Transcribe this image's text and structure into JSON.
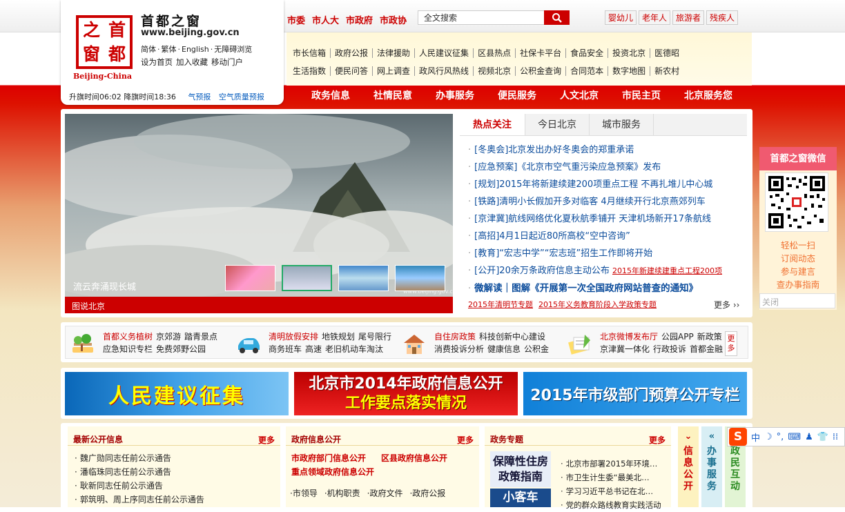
{
  "header": {
    "seal_chars": [
      "首",
      "之",
      "都",
      "窗"
    ],
    "seal_en": "Beijing-China",
    "site_name": "首都之窗",
    "url": "www.beijing.gov.cn",
    "langs": [
      "简体",
      "·",
      "繁体",
      "·",
      "English",
      "·",
      "无障碍浏览"
    ],
    "home_links": [
      "设为首页",
      "加入收藏",
      "移动门户"
    ],
    "flag_up": "升旗时间06:02",
    "flag_down": "降旗时间18:36",
    "weather": "气预报",
    "air": "空气质量预报",
    "top_links": [
      "市委",
      "市人大",
      "市政府",
      "市政协"
    ],
    "search_value": "全文搜索",
    "audience": [
      "婴幼儿",
      "老年人",
      "旅游者",
      "残疾人"
    ]
  },
  "links_row1": [
    "市长信箱",
    "政府公报",
    "法律援助",
    "人民建议征集",
    "区县热点",
    "社保卡平台",
    "食品安全",
    "投资北京",
    "医德昭"
  ],
  "links_row2": [
    "生活指数",
    "便民问答",
    "网上调查",
    "政风行风热线",
    "视频北京",
    "公积金查询",
    "合同范本",
    "数字地图",
    "新农村"
  ],
  "nav": [
    "政务信息",
    "社情民意",
    "办事服务",
    "便民服务",
    "人文北京",
    "市民主页",
    "北京服务您"
  ],
  "slideshow": {
    "caption": "流云奔涌现长城",
    "bar_label": "图说北京",
    "watermark": "www.beijing.gov.cn"
  },
  "tabs": [
    "热点关注",
    "今日北京",
    "城市服务"
  ],
  "news": [
    {
      "tag": "[冬奥会]",
      "text": "北京发出办好冬奥会的郑重承诺"
    },
    {
      "tag": "[应急预案]",
      "text": "《北京市空气重污染应急预案》发布"
    },
    {
      "tag": "[规划]",
      "text": "2015年将新建续建200项重点工程 不再扎堆儿中心城"
    },
    {
      "tag": "[铁路]",
      "text": "清明小长假加开多对临客 4月继续开行北京燕郊列车"
    },
    {
      "tag": "[京津冀]",
      "text": "航线网络优化夏秋航季铺开 天津机场新开17条航线"
    },
    {
      "tag": "[高招]",
      "text": "4月1日起近80所高校“空中咨询”"
    },
    {
      "tag": "[教育]",
      "text": "“宏志中学”“宏志班”招生工作即将开始"
    },
    {
      "tag": "[公开]",
      "text": "20余万条政府信息主动公布",
      "extra": "2015年新建续建重点工程200项"
    }
  ],
  "news_feature": "微解读｜图解《开展第一次全国政府网站普查的通知》",
  "specials": [
    "2015年清明节专题",
    "2015年义务教育阶段入学政策专题"
  ],
  "more": "更多",
  "wechat": {
    "title": "首都之窗微信",
    "links": [
      "轻松一扫",
      "订阅动态",
      "参与建言",
      "查办事指南"
    ],
    "close": "关闭"
  },
  "categories": [
    {
      "row1": [
        "首都义务植树",
        "京郊游",
        "踏青景点"
      ],
      "row2": [
        "应急知识专栏",
        "免费郊野公园"
      ],
      "red": [
        0,
        0
      ]
    },
    {
      "row1": [
        "清明放假安排",
        "地铁规划",
        "尾号限行"
      ],
      "row2": [
        "商务班车",
        "高速",
        "老旧机动车淘汰"
      ],
      "red": [
        0
      ]
    },
    {
      "row1": [
        "自住房政策",
        "科技创新中心建设"
      ],
      "row2": [
        "消费投诉分析",
        "健康信息",
        "公积金"
      ],
      "red": [
        0
      ]
    },
    {
      "row1": [
        "北京微博发布厅",
        "公园APP",
        "新政策"
      ],
      "row2": [
        "京津冀一体化",
        "行政投诉",
        "首都金融"
      ],
      "red": [
        0
      ]
    }
  ],
  "cat_more": "更多",
  "banners": {
    "b1": "人民建议征集",
    "b2_line1": "北京市2014年政府信息公开",
    "b2_line2": "工作要点落实情况",
    "b3": "2015年市级部门预算公开专栏"
  },
  "bottom": {
    "col1_title": "最新公开信息",
    "col1_items": [
      "魏广勋同志任前公示通告",
      "潘临珠同志任前公示通告",
      "耿新同志任前公示通告",
      "郭筑明、周上序同志任前公示通告"
    ],
    "col2_title": "政府信息公开",
    "col2_red": [
      "市政府部门信息公开",
      "区县政府信息公开",
      "重点领域政府信息公开"
    ],
    "col2_links": [
      "·市领导",
      "·机构职责",
      "·政府文件",
      "·政府公报"
    ],
    "col3_title": "政务专题",
    "col3_box1": "保障性住房政策指南",
    "col3_box2": "小客车",
    "col3_items": [
      "北京市部署2015年环境…",
      "市卫生计生委“最美北…",
      "学习习近平总书记在北…",
      "党的群众路线教育实践活动"
    ],
    "vt1": "信息公开",
    "vt2": "办事服务",
    "vt3": "政民互动"
  },
  "ime": {
    "logo": "S",
    "items": [
      "中",
      "☽",
      "°,",
      "⌨",
      "♟",
      "👕",
      "⁞⁞"
    ]
  }
}
